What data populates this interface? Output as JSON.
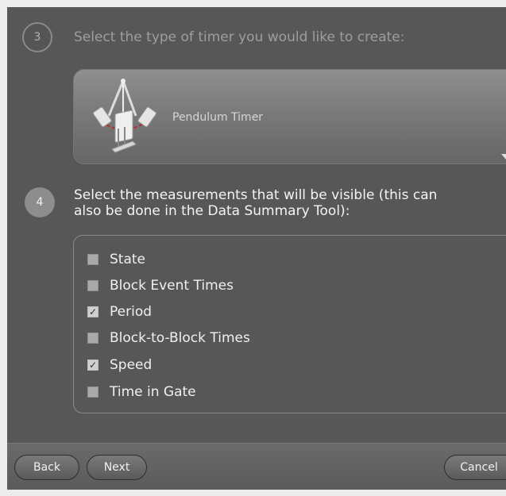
{
  "step3": {
    "number": "3",
    "text": "Select the type of timer you would like to create:"
  },
  "timer": {
    "selected_label": "Pendulum Timer",
    "icon": "pendulum-timer-icon"
  },
  "step4": {
    "number": "4",
    "text_line1": "Select the measurements that will be visible (this can",
    "text_line2": "also be done in the Data Summary Tool):"
  },
  "measurements": [
    {
      "label": "State",
      "checked": false
    },
    {
      "label": "Block Event Times",
      "checked": false
    },
    {
      "label": "Period",
      "checked": true
    },
    {
      "label": "Block-to-Block Times",
      "checked": false
    },
    {
      "label": "Speed",
      "checked": true
    },
    {
      "label": "Time in Gate",
      "checked": false
    }
  ],
  "footer": {
    "back_label": "Back",
    "next_label": "Next",
    "cancel_label": "Cancel"
  },
  "colors": {
    "panel_bg": "#575757",
    "text_active": "#f4f4f4",
    "text_inactive": "#9e9e9e"
  }
}
